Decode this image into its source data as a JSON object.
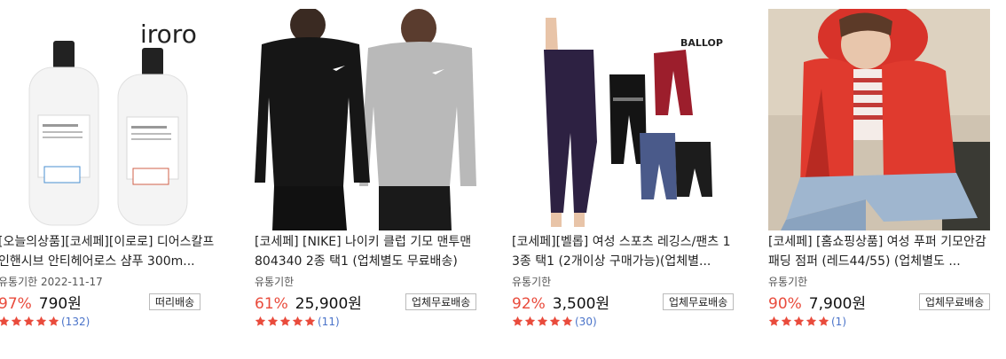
{
  "products": [
    {
      "title": "[오늘의상품][코세페][이로로] 디어스칼프 인핸시브 안티헤어로스 샴푸 300m...",
      "expiry": "유통기한 2022-11-17",
      "discount": "97%",
      "price": "790원",
      "shipping": "떠리배송",
      "review_count": "(132)",
      "rating": 5,
      "image": "shampoo-bottles",
      "brand_logo": "iroro"
    },
    {
      "title": "[코세페] [NIKE] 나이키 클럽 기모 맨투맨 804340 2종 택1 (업체별도 무료배송)",
      "expiry": "유통기한",
      "discount": "61%",
      "price": "25,900원",
      "shipping": "업체무료배송",
      "review_count": "(11)",
      "rating": 5,
      "image": "nike-sweatshirts"
    },
    {
      "title": "[코세페][벨롭] 여성 스포츠 레깅스/팬츠 13종 택1 (2개이상 구매가능)(업체별...",
      "expiry": "유통기한",
      "discount": "92%",
      "price": "3,500원",
      "shipping": "업체무료배송",
      "review_count": "(30)",
      "rating": 5,
      "image": "leggings",
      "brand_logo": "BALLOP"
    },
    {
      "title": "[코세페] [홈쇼핑상품] 여성 푸퍼 기모안감 패딩 점퍼 (레드44/55) (업체별도 ...",
      "expiry": "유통기한",
      "discount": "90%",
      "price": "7,900원",
      "shipping": "업체무료배송",
      "review_count": "(1)",
      "rating": 5,
      "image": "red-padding-jacket"
    }
  ],
  "colors": {
    "discount": "#e94b3c",
    "star": "#e94b3c",
    "review_count": "#4a73c9"
  }
}
